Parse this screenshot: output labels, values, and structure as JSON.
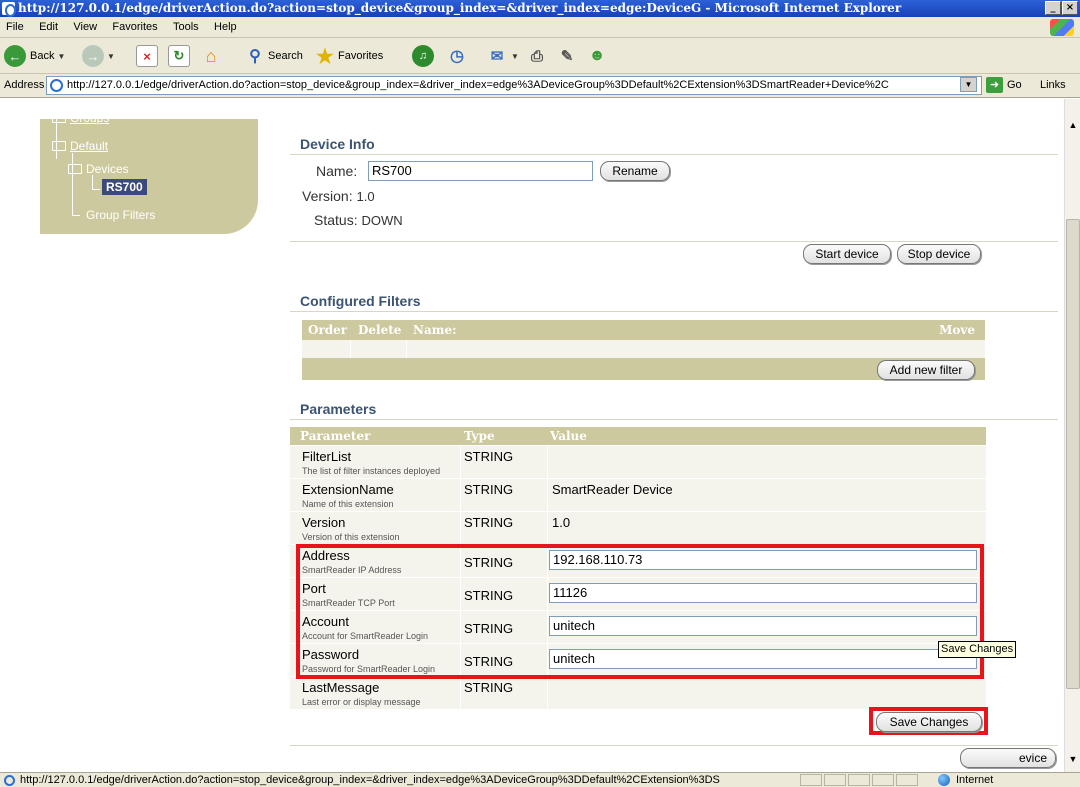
{
  "browser": {
    "title": "http://127.0.0.1/edge/driverAction.do?action=stop_device&group_index=&driver_index=edge:DeviceG - Microsoft Internet Explorer",
    "window_buttons": [
      "_",
      "×"
    ],
    "menu": [
      "File",
      "Edit",
      "View",
      "Favorites",
      "Tools",
      "Help"
    ],
    "toolbar": {
      "back": "Back",
      "search": "Search",
      "favorites": "Favorites"
    },
    "address_label": "Address",
    "address_url": "http://127.0.0.1/edge/driverAction.do?action=stop_device&group_index=&driver_index=edge%3ADeviceGroup%3DDefault%2CExtension%3DSmartReader+Device%2C",
    "go_label": "Go",
    "links_label": "Links",
    "status_url": "http://127.0.0.1/edge/driverAction.do?action=stop_device&group_index=&driver_index=edge%3ADeviceGroup%3DDefault%2CExtension%3DS",
    "zone": "Internet"
  },
  "tree": {
    "groups": "Groups",
    "default": "Default",
    "devices": "Devices",
    "selected_device": "RS700",
    "group_filters": "Group Filters"
  },
  "device_info": {
    "title": "Device Info",
    "name_label": "Name:",
    "name_value": "RS700",
    "rename_button": "Rename",
    "version_label": "Version:",
    "version_value": "1.0",
    "status_label": "Status:",
    "status_value": "DOWN",
    "start_button": "Start device",
    "stop_button": "Stop device"
  },
  "filters": {
    "title": "Configured Filters",
    "columns": [
      "Order",
      "Delete",
      "Name:",
      "Move"
    ],
    "add_button": "Add new filter"
  },
  "parameters": {
    "title": "Parameters",
    "columns": [
      "Parameter",
      "Type",
      "Value"
    ],
    "rows": [
      {
        "name": "FilterList",
        "desc": "The list of filter instances deployed",
        "type": "STRING",
        "value": ""
      },
      {
        "name": "ExtensionName",
        "desc": "Name of this extension",
        "type": "STRING",
        "value": "SmartReader Device"
      },
      {
        "name": "Version",
        "desc": "Version of this extension",
        "type": "STRING",
        "value": "1.0"
      },
      {
        "name": "Address",
        "desc": "SmartReader IP Address",
        "type": "STRING",
        "value": "192.168.110.73"
      },
      {
        "name": "Port",
        "desc": "SmartReader TCP Port",
        "type": "STRING",
        "value": "11126"
      },
      {
        "name": "Account",
        "desc": "Account for SmartReader Login",
        "type": "STRING",
        "value": "unitech"
      },
      {
        "name": "Password",
        "desc": "Password for SmartReader Login",
        "type": "STRING",
        "value": "unitech"
      },
      {
        "name": "LastMessage",
        "desc": "Last error or display message",
        "type": "STRING",
        "value": ""
      }
    ],
    "save_button": "Save Changes",
    "delete_button_fragment": "evice"
  },
  "tooltip": "Save Changes",
  "colors": {
    "table_header": "#cdc99e",
    "highlight": "#e8131b",
    "section_title": "#3c5471",
    "title_bar": "#1f4fc8"
  }
}
